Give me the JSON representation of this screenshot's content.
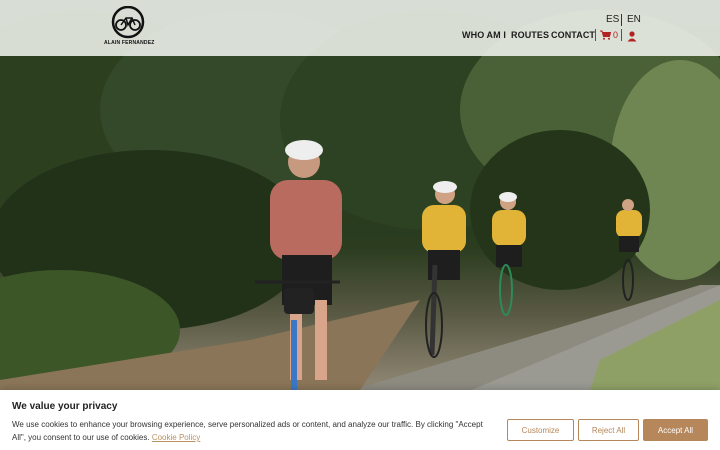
{
  "header": {
    "logo_text": "ALAIN FERNANDEZ",
    "lang_es": "ES",
    "lang_en": "EN",
    "nav": {
      "who": "WHO AM I",
      "routes": "ROUTES",
      "contact": "CONTACT"
    },
    "cart_count": "0"
  },
  "cookie": {
    "title": "We value your privacy",
    "text": "We use cookies to enhance your browsing experience, serve personalized ads or content, and analyze our traffic. By clicking \"Accept All\", you consent to our use of cookies.",
    "link": "Cookie Policy",
    "customize": "Customize",
    "reject": "Reject All",
    "accept": "Accept All"
  },
  "colors": {
    "accent": "#b5875a",
    "cart": "#b22222"
  }
}
